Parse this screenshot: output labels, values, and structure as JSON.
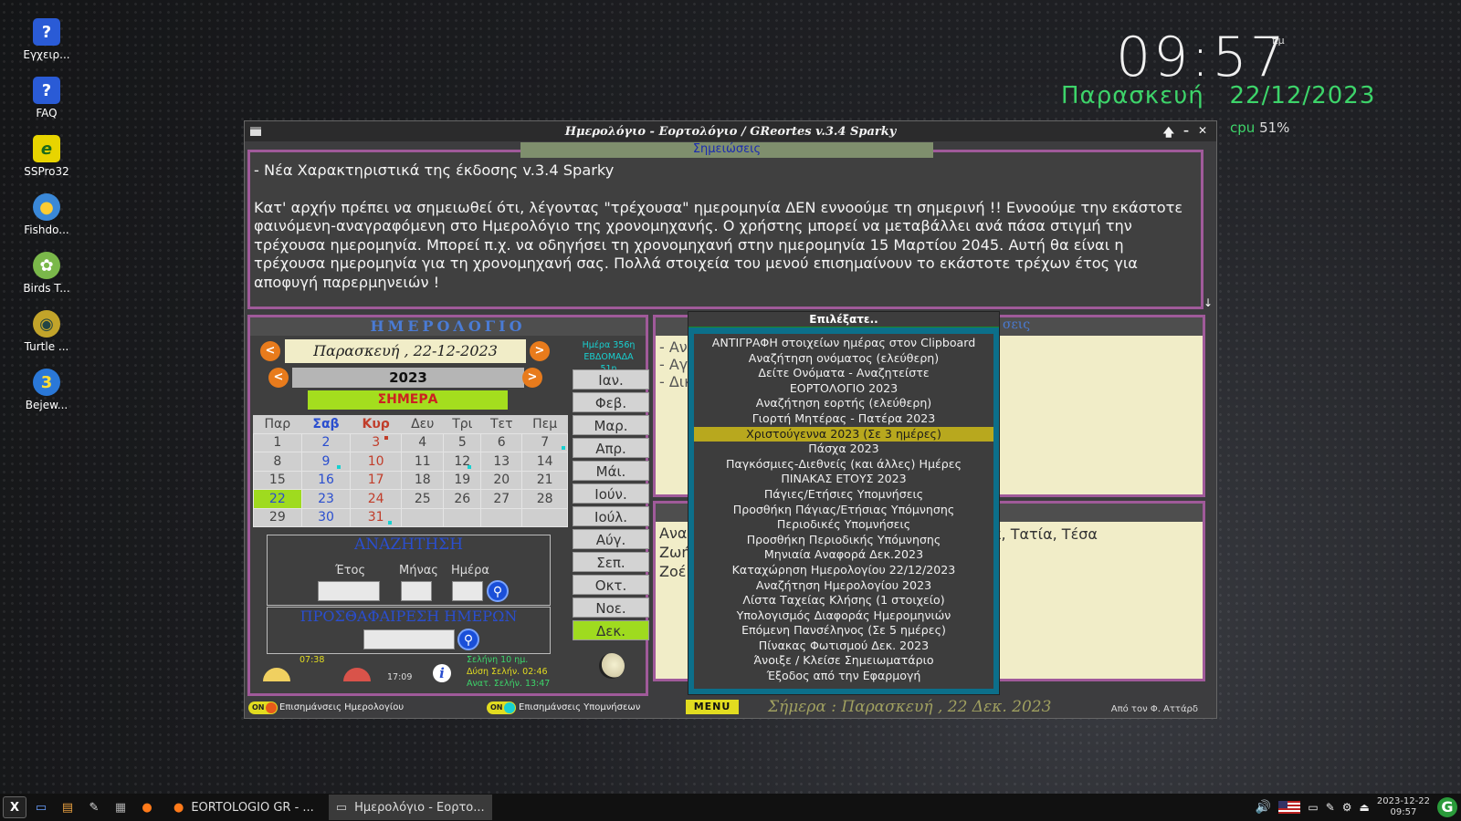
{
  "desktop": {
    "icons": [
      {
        "label": "Εγχειρ..."
      },
      {
        "label": "FAQ"
      },
      {
        "label": "SSPro32"
      },
      {
        "label": "Fishdo..."
      },
      {
        "label": "Birds T..."
      },
      {
        "label": "Turtle ..."
      },
      {
        "label": "Bejew..."
      }
    ]
  },
  "clock_widget": {
    "time": "09:57",
    "ampm": "πμ",
    "date": "Παρασκευή   22/12/2023",
    "cpu_label": "cpu",
    "cpu_value": "51%"
  },
  "window": {
    "title": "Ημερολόγιο - Εορτολόγιο / GReortes v.3.4 Sparky",
    "controls": {
      "up": "🡅",
      "minimize": "–",
      "close": "✕"
    },
    "notes_tab": "Σημειώσεις",
    "notes_heading": "- Νέα Χαρακτηριστικά της έκδοσης v.3.4 Sparky",
    "notes_body": "Κατ' αρχήν πρέπει να σημειωθεί ότι, λέγοντας \"τρέχουσα\" ημερομηνία ΔΕΝ εννοούμε τη σημερινή !! Εννοούμε την εκάστοτε φαινόμενη-αναγραφόμενη στο Ημερολόγιο της χρονομηχανής. Ο χρήστης μπορεί να μεταβάλλει ανά πάσα στιγμή την τρέχουσα ημερομηνία. Μπορεί π.χ. να οδηγήσει τη χρονομηχανή στην ημερομηνία 15 Μαρτίου 2045. Αυτή θα είναι η τρέχουσα ημερομηνία για τη χρονομηχανή σας. Πολλά στοιχεία του μενού επισημαίνουν το εκάστοτε τρέχων έτος για αποφυγή παρερμηνειών !",
    "scroll_icon": "↓"
  },
  "calendar": {
    "title": "ΗΜΕΡΟΛΟΓΙΟ",
    "current_date": "Παρασκευή , 22-12-2023",
    "year": "2023",
    "today_button": "ΣΗΜΕΡΑ",
    "day_info": [
      "Ημέρα 356η",
      "ΕΒΔΟΜΑΔΑ 51η"
    ],
    "weekdays": [
      "Παρ",
      "Σαβ",
      "Κυρ",
      "Δευ",
      "Τρι",
      "Τετ",
      "Πεμ"
    ],
    "weeks": [
      [
        "1",
        "2",
        "3",
        "4",
        "5",
        "6",
        "7"
      ],
      [
        "8",
        "9",
        "10",
        "11",
        "12",
        "13",
        "14"
      ],
      [
        "15",
        "16",
        "17",
        "18",
        "19",
        "20",
        "21"
      ],
      [
        "22",
        "23",
        "24",
        "25",
        "26",
        "27",
        "28"
      ],
      [
        "29",
        "30",
        "31",
        "",
        "",
        "",
        ""
      ]
    ],
    "months": [
      "Ιαν.",
      "Φεβ.",
      "Μαρ.",
      "Απρ.",
      "Μάι.",
      "Ιούν.",
      "Ιούλ.",
      "Αύγ.",
      "Σεπ.",
      "Οκτ.",
      "Νοε.",
      "Δεκ."
    ],
    "active_month": "Δεκ.",
    "search": {
      "title": "ΑΝΑΖΗΤΗΣΗ",
      "year_label": "Έτος",
      "month_label": "Μήνας",
      "day_label": "Ημέρα"
    },
    "add_remove": {
      "title": "ΠΡΟΣΘΑΦΑΙΡΕΣΗ ΗΜΕΡΩΝ"
    },
    "sunrise": "07:38",
    "sunset": "17:09",
    "moon_info": [
      "Σελήνη 10 ημ.",
      "Δύση Σελήν. 02:46",
      "Ανατ. Σελήν. 13:47"
    ]
  },
  "right_panel": {
    "top_header_partial": "σεις",
    "top_lines": [
      "- Ανα",
      "- Αγί",
      "- Δικ"
    ],
    "bottom_lines": [
      "Αναα",
      "Ζωή",
      "Ζοέ"
    ],
    "bottom_right_text": "α, Τατία, Τέσα"
  },
  "popup_menu": {
    "title": "Επιλέξατε..",
    "items": [
      "ΑΝΤΙΓΡΑΦΗ στοιχείων ημέρας στον Clipboard",
      "Αναζήτηση ονόματος (ελεύθερη)",
      "Δείτε Ονόματα - Αναζητείστε",
      "ΕΟΡΤΟΛΟΓΙΟ 2023",
      "Αναζήτηση εορτής (ελεύθερη)",
      "Γιορτή Μητέρας - Πατέρα 2023",
      "Χριστούγεννα 2023  (Σε 3 ημέρες)",
      "Πάσχα 2023",
      "Παγκόσμιες-Διεθνείς (και άλλες) Ημέρες",
      "ΠΙΝΑΚΑΣ ΕΤΟΥΣ 2023",
      "Πάγιες/Ετήσιες Υπομνήσεις",
      "Προσθήκη Πάγιας/Ετήσιας Υπόμνησης",
      "Περιοδικές Υπομνήσεις",
      "Προσθήκη Περιοδικής Υπόμνησης",
      "Μηνιαία Αναφορά Δεκ.2023",
      "Καταχώρηση Ημερολογίου 22/12/2023",
      "Αναζήτηση Ημερολογίου 2023",
      "Λίστα Ταχείας Κλήσης (1 στοιχείο)",
      "Υπολογισμός Διαφοράς Ημερομηνιών",
      "Επόμενη Πανσέληνος (Σε 5 ημέρες)",
      "Πίνακας Φωτισμού Δεκ. 2023",
      "Άνοιξε / Κλείσε Σημειωματάριο",
      "Έξοδος από την Εφαρμογή"
    ],
    "selected_index": 6
  },
  "bottom_bar": {
    "toggle1_state": "ON",
    "toggle1_label": "Επισημάνσεις Ημερολογίου",
    "toggle2_state": "ON",
    "toggle2_label": "Επισημάνσεις Υπομνήσεων",
    "menu_button": "MENU",
    "today_text": "Σήμερα : Παρασκευή , 22 Δεκ. 2023",
    "author": "Από τον Φ. Αττάρδ"
  },
  "taskbar": {
    "tasks": [
      {
        "label": "EORTOLOGIO GR - ..."
      },
      {
        "label": "Ημερολόγιο - Εορτο..."
      }
    ],
    "tray_date": "2023-12-22",
    "tray_time": "09:57"
  }
}
